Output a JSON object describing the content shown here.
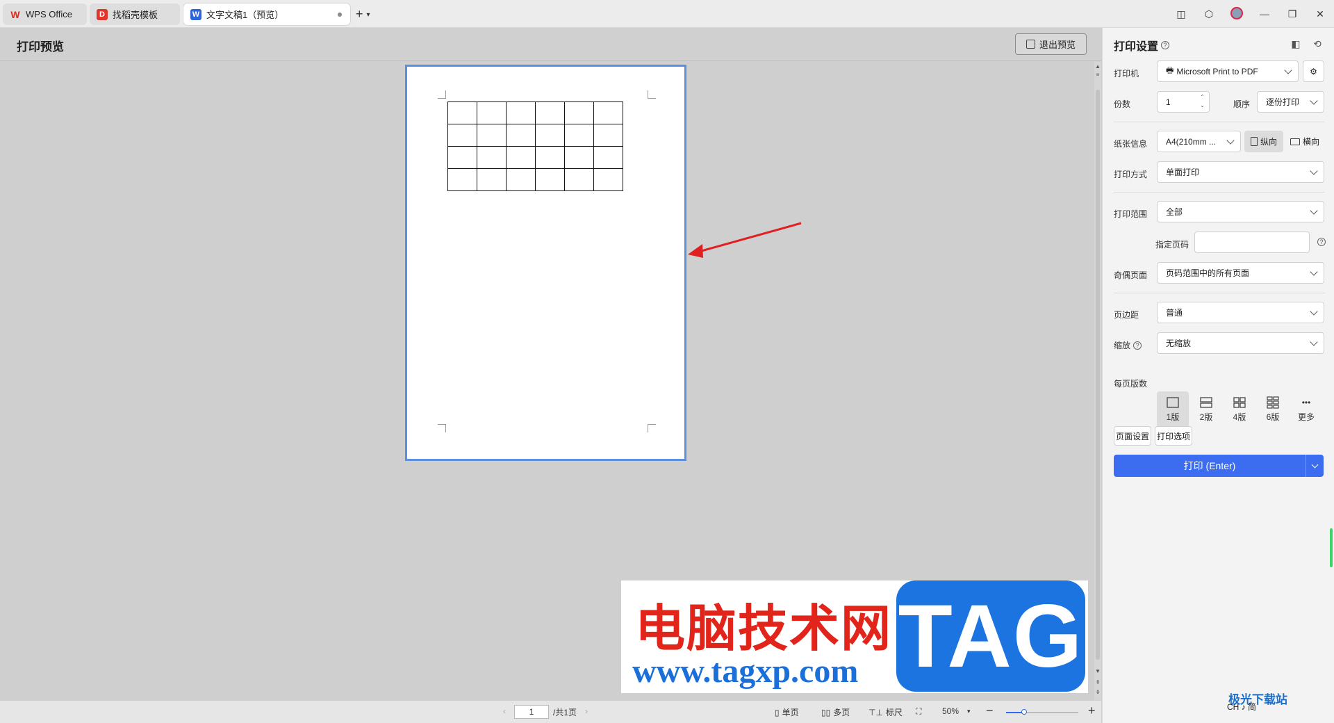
{
  "titlebar": {
    "tabs": [
      {
        "label": "WPS Office",
        "logo": "W"
      },
      {
        "label": "找稻壳模板",
        "logo": "D"
      },
      {
        "label": "文字文稿1（预览）",
        "logo": "W"
      }
    ],
    "icons": [
      "layout-icon",
      "cube-icon",
      "avatar",
      "minimize-icon",
      "restore-icon",
      "close-icon"
    ]
  },
  "preview": {
    "title": "打印预览",
    "exit_label": "退出预览",
    "table": {
      "rows": 4,
      "cols": 6
    }
  },
  "watermark": {
    "cn_text": "电脑技术网",
    "url_text": "www.tagxp.com",
    "tag_text": "TAG"
  },
  "statusbar": {
    "page_value": "1",
    "page_total": "/共1页",
    "single_page": "单页",
    "multi_page": "多页",
    "ruler": "标尺",
    "zoom": "50%",
    "zoom_fraction": 0.25
  },
  "panel": {
    "title": "打印设置",
    "printer_label": "打印机",
    "printer_value": "Microsoft Print to PDF",
    "copies_label": "份数",
    "copies_value": "1",
    "order_label": "顺序",
    "order_value": "逐份打印",
    "paper_label": "纸张信息",
    "paper_value": "A4(210mm ...",
    "portrait_label": "纵向",
    "landscape_label": "横向",
    "mode_label": "打印方式",
    "mode_value": "单面打印",
    "range_label": "打印范围",
    "range_value": "全部",
    "page_spec_label": "指定页码",
    "page_spec_value": "",
    "odd_even_label": "奇偶页面",
    "odd_even_value": "页码范围中的所有页面",
    "margin_label": "页边距",
    "margin_value": "普通",
    "scale_label": "缩放",
    "scale_value": "无缩放",
    "per_page_label": "每页版数",
    "layouts": [
      "1版",
      "2版",
      "4版",
      "6版",
      "更多"
    ],
    "page_setup_label": "页面设置",
    "print_options_label": "打印选项",
    "print_button_label": "打印 (Enter)"
  },
  "tray": {
    "ime": "CH ♪ 简",
    "site": "极光下载站"
  }
}
